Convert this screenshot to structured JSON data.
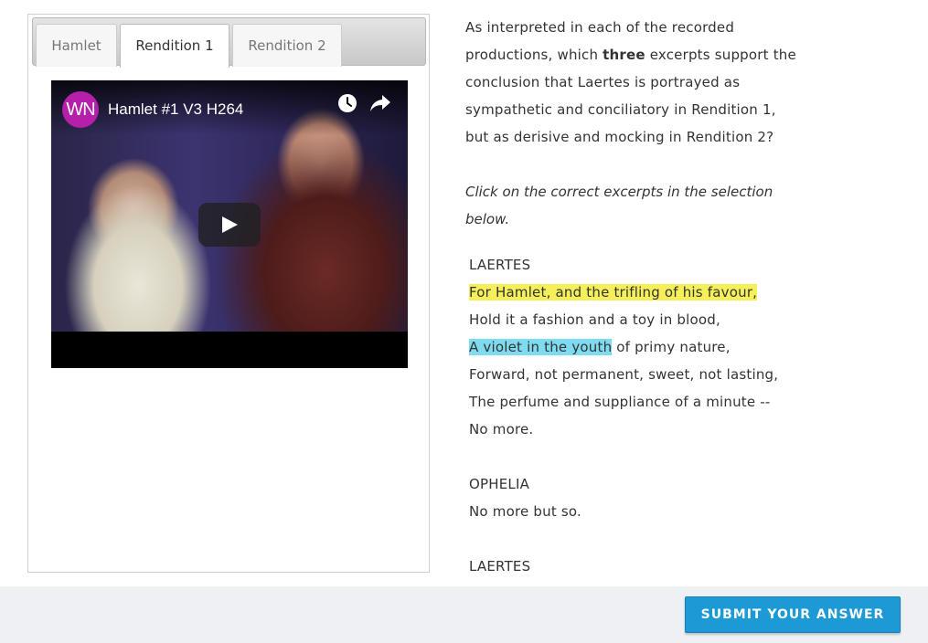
{
  "tabs": [
    {
      "label": "Hamlet",
      "active": false
    },
    {
      "label": "Rendition 1",
      "active": true
    },
    {
      "label": "Rendition 2",
      "active": false
    }
  ],
  "video": {
    "channel_logo": "WN",
    "title": "Hamlet #1 V3 H264",
    "icons": [
      "clock-icon",
      "share-icon",
      "play-icon"
    ],
    "logo_color": "#b51fa9"
  },
  "question": {
    "part1": "As interpreted in each of the recorded productions, which ",
    "emphasis": "three",
    "part2": " excerpts support the conclusion that Laertes is portrayed as sympathetic and conciliatory in Rendition 1, but as derisive and mocking in Rendition 2?"
  },
  "instruction": "Click on the correct excerpts in the selection below.",
  "passage": {
    "speaker1": "LAERTES",
    "line1": "For Hamlet, and the trifling of his favour,",
    "line2": "Hold it a fashion and a toy in blood,",
    "line3_selected": "A violet in the youth",
    "line3_rest": " of primy nature,",
    "line4": "Forward, not permanent, sweet, not lasting,",
    "line5": "The perfume and suppliance of a minute --",
    "line6": "No more.",
    "speaker2": "OPHELIA",
    "line7": "No more but so.",
    "speaker3": "LAERTES"
  },
  "highlight_colors": {
    "yellow": "#f5f05a",
    "blue": "#7fdcf0"
  },
  "submit_label": "SUBMIT YOUR ANSWER",
  "accent_color": "#1b9ad6"
}
